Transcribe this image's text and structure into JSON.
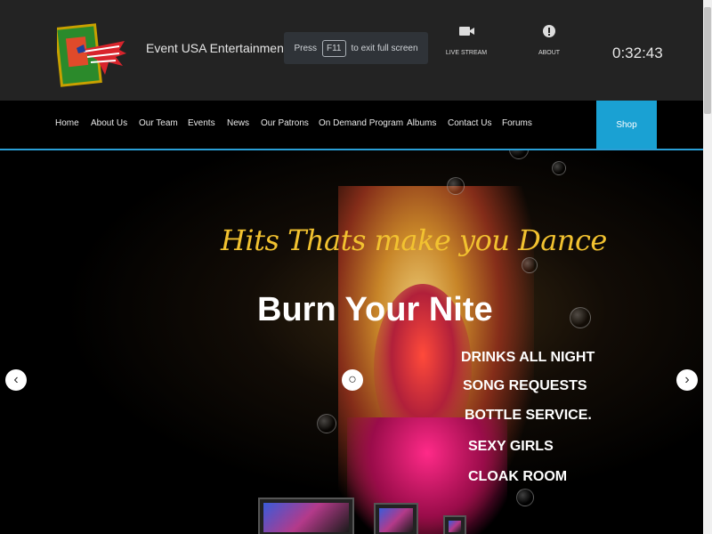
{
  "header": {
    "brand": "Event USA Entertainment",
    "fullscreen": {
      "prefix": "Press",
      "key": "F11",
      "suffix": "to exit full screen"
    },
    "live_stream_label": "LIVE STREAM",
    "about_label": "ABOUT",
    "clock": "0:32:43"
  },
  "nav": {
    "items": [
      "Home",
      "About Us",
      "Our Team",
      "Events",
      "News",
      "Our Patrons",
      "On Demand Program",
      "Albums",
      "Contact Us",
      "Forums"
    ],
    "shop_label": "Shop"
  },
  "hero": {
    "tagline": "Hits Thats make you Dance",
    "title": "Burn Your Nite",
    "features": [
      "DRINKS ALL NIGHT",
      "SONG REQUESTS",
      "BOTTLE SERVICE.",
      "SEXY GIRLS",
      "CLOAK ROOM"
    ]
  },
  "colors": {
    "accent": "#1aa1d3",
    "tagline": "#f2c230",
    "header_bg": "#232323"
  },
  "icons": {
    "live_stream": "video-camera-icon",
    "about": "info-icon",
    "prev": "chevron-left-icon",
    "next": "chevron-right-icon"
  }
}
